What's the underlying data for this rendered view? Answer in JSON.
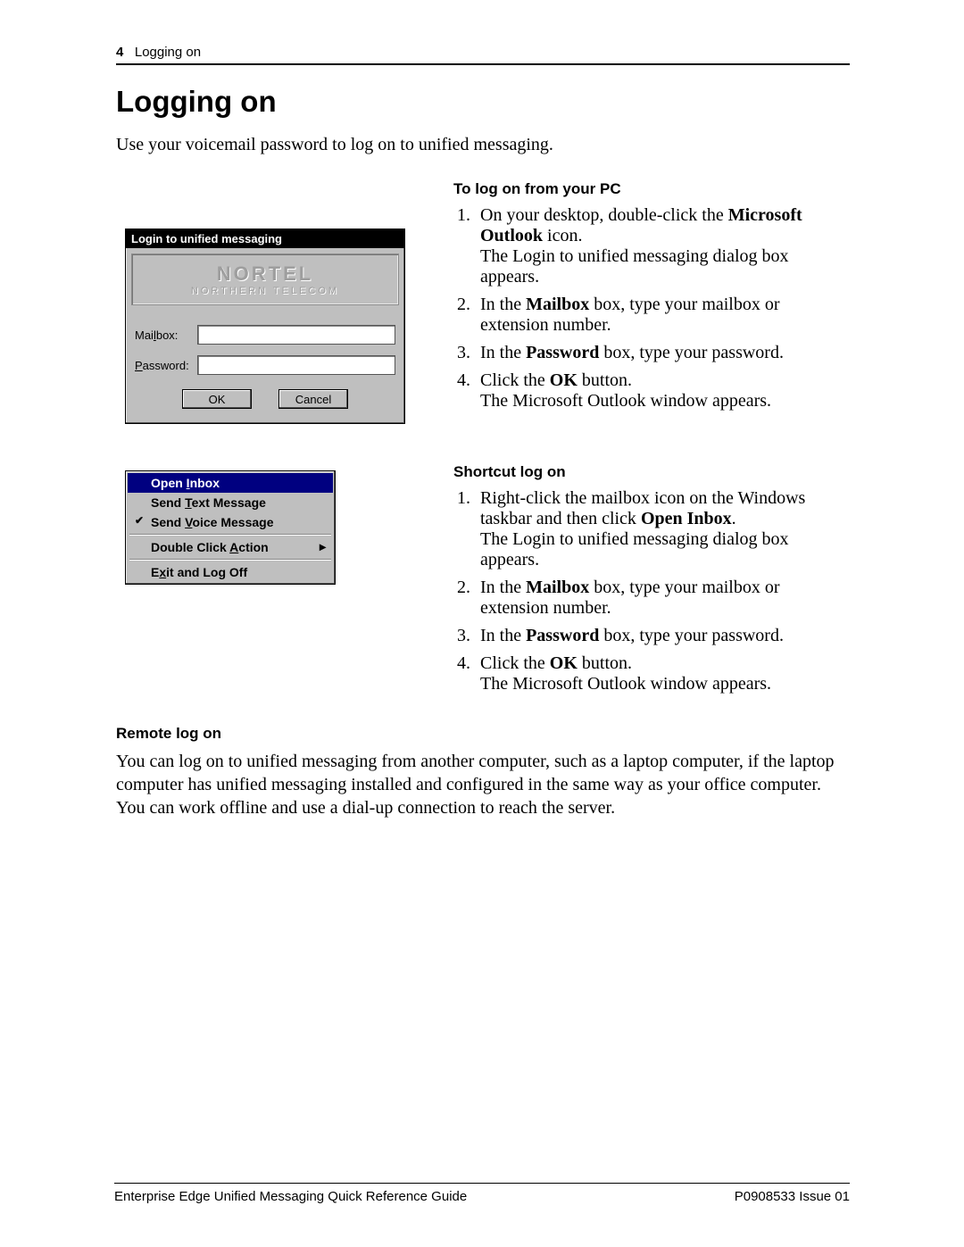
{
  "header": {
    "page_number": "4",
    "section": "Logging on"
  },
  "title": "Logging on",
  "intro": "Use your voicemail password to log on to unified messaging.",
  "dialog": {
    "title": "Login to unified messaging",
    "logo_main": "NORTEL",
    "logo_sub": "NORTHERN TELECOM",
    "mailbox_label": "Mailbox:",
    "password_label": "Password:",
    "mailbox_value": "",
    "password_value": "",
    "ok": "OK",
    "cancel": "Cancel"
  },
  "section_pc": {
    "heading": "To log on from your PC",
    "items": [
      {
        "pre": "On your desktop, double-click the ",
        "b": "Microsoft Outlook",
        "post": " icon.\nThe Login to unified messaging dialog box appears."
      },
      {
        "pre": "In the ",
        "b": "Mailbox",
        "post": " box, type your mailbox or extension number."
      },
      {
        "pre": "In the ",
        "b": "Password",
        "post": " box, type your password."
      },
      {
        "pre": "Click the ",
        "b": "OK",
        "post": " button.\nThe Microsoft Outlook window appears."
      }
    ]
  },
  "menu": {
    "open_inbox": "Open Inbox",
    "send_text": "Send Text Message",
    "send_voice": "Send Voice Message",
    "double_click": "Double Click Action",
    "exit": "Exit and Log Off"
  },
  "section_shortcut": {
    "heading": "Shortcut log on",
    "items": [
      {
        "pre": "Right-click the mailbox icon on the Windows taskbar and then click ",
        "b": "Open Inbox",
        "post": ".\nThe Login to unified messaging dialog box appears."
      },
      {
        "pre": "In the ",
        "b": "Mailbox",
        "post": " box, type your mailbox or extension number."
      },
      {
        "pre": "In the ",
        "b": "Password",
        "post": " box, type your password."
      },
      {
        "pre": "Click the ",
        "b": "OK",
        "post": " button.\nThe Microsoft Outlook window appears."
      }
    ]
  },
  "section_remote": {
    "heading": "Remote log on",
    "body": "You can log on to unified messaging from another computer, such as a laptop computer, if the laptop computer has unified messaging installed and configured in the same way as your office computer. You can work offline and use a dial-up connection to reach the server."
  },
  "footer": {
    "left": "Enterprise Edge Unified Messaging Quick Reference Guide",
    "right": "P0908533 Issue 01"
  }
}
